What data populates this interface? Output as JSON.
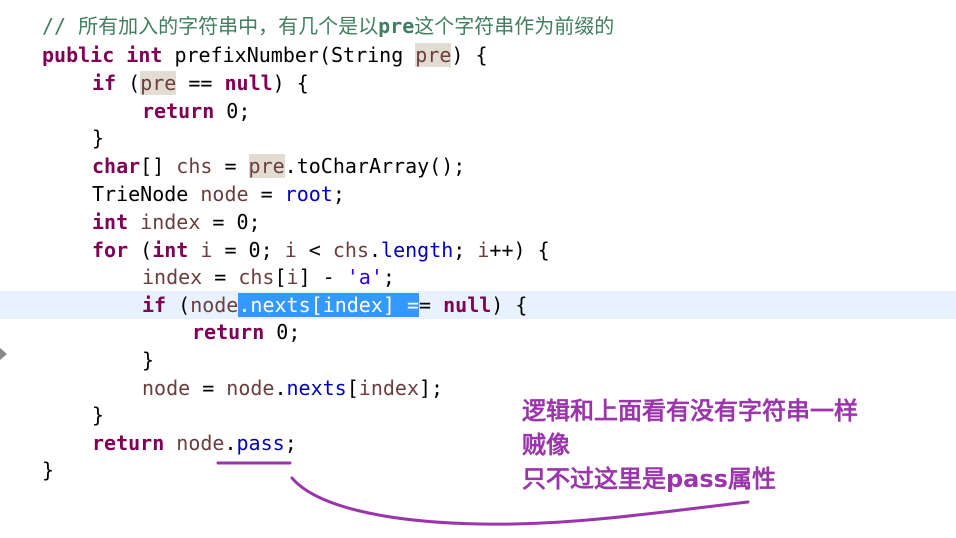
{
  "colors": {
    "keyword": "#7f0055",
    "comment": "#3f7f5f",
    "field": "#0000c0",
    "string": "#2a00ff",
    "selection": "#3399ff",
    "current_line": "#e8f2fe",
    "annotation": "#9b35ab"
  },
  "code": {
    "comment": {
      "prefix": "// 所有加入的字符串中，有几个是以",
      "bold": "pre",
      "suffix": "这个字符串作为前缀的"
    },
    "l2": {
      "kw1": "public",
      "kw2": "int",
      "sig": " prefixNumber(String ",
      "param": "pre",
      "end": ") {"
    },
    "l3": {
      "kw": "if",
      "open": " (",
      "var": "pre",
      "op": " == ",
      "null": "null",
      "end": ") {"
    },
    "l4": {
      "kw": "return",
      "end": " 0;"
    },
    "l5": {
      "text": "}"
    },
    "l6": {
      "kw": "char",
      "a": "[] ",
      "var": "chs",
      "b": " = ",
      "var2": "pre",
      "c": ".toCharArray();"
    },
    "l7": {
      "a": "TrieNode ",
      "var": "node",
      "b": " = ",
      "field": "root",
      "c": ";"
    },
    "l8": {
      "kw": "int",
      "var": " index",
      "b": " = 0;"
    },
    "l9": {
      "kw": "for",
      "a": " (",
      "kw2": "int",
      "var": " i",
      "b": " = 0; ",
      "var2": "i",
      "c": " < ",
      "var3": "chs",
      "d": ".",
      "field": "length",
      "e": "; ",
      "var4": "i",
      "f": "++) {"
    },
    "l10": {
      "var": "index",
      "a": " = ",
      "var2": "chs",
      "b": "[",
      "var3": "i",
      "c": "] - ",
      "str": "'a'",
      "d": ";"
    },
    "l11": {
      "kw": "if",
      "a": " (",
      "var": "node",
      "sel_field": "nexts",
      "sel1": ".",
      "sel2": "[",
      "sel_var": "index",
      "sel3": "] =",
      "b": "= ",
      "null": "null",
      "c": ") {"
    },
    "l12": {
      "kw": "return",
      "end": " 0;"
    },
    "l13": {
      "text": "}"
    },
    "l14": {
      "var": "node",
      "a": " = ",
      "var2": "node",
      "b": ".",
      "field": "nexts",
      "c": "[",
      "var3": "index",
      "d": "];"
    },
    "l15": {
      "text": "}"
    },
    "l16": {
      "kw": "return",
      "a": " ",
      "var": "node",
      "b": ".",
      "field": "pass",
      "c": ";"
    },
    "l17": {
      "text": "}"
    }
  },
  "annotation": {
    "line1": "逻辑和上面看有没有字符串一样",
    "line2": "贼像",
    "line3": "只不过这里是pass属性"
  }
}
